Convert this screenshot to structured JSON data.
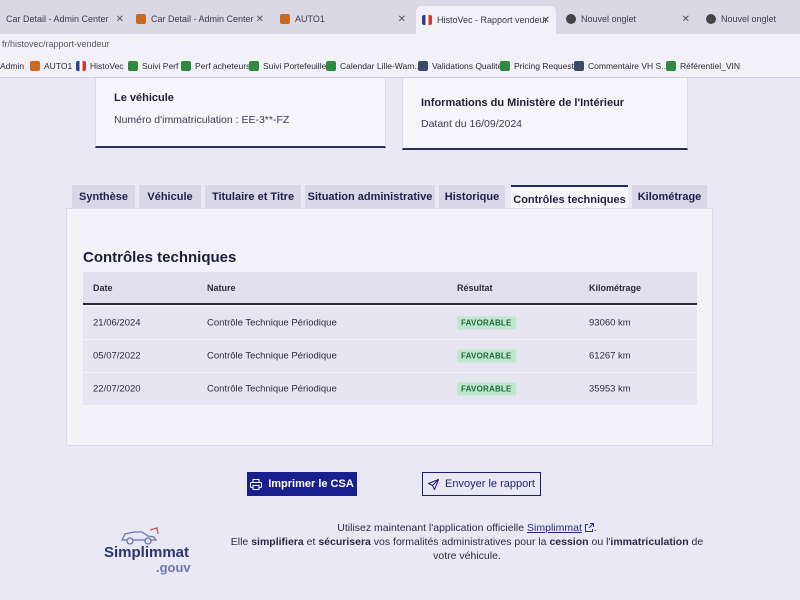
{
  "browser": {
    "tabs": [
      {
        "title": "Car Detail - Admin Center",
        "active": false
      },
      {
        "title": "Car Detail - Admin Center",
        "active": false
      },
      {
        "title": "AUTO1",
        "active": false
      },
      {
        "title": "HistoVec - Rapport vendeur",
        "active": true
      },
      {
        "title": "Nouvel onglet",
        "active": false
      },
      {
        "title": "Nouvel onglet",
        "active": false
      }
    ],
    "url": "fr/histovec/rapport-vendeur",
    "bookmarks": [
      "Admin",
      "AUTO1",
      "HistoVec",
      "Suivi Perf",
      "Perf acheteurs",
      "Suivi Portefeuille",
      "Calendar Lille-Wam...",
      "Validations Qualité",
      "Pricing Requests",
      "Commentaire VH S...",
      "Référentiel_VIN"
    ]
  },
  "vehicle_card": {
    "title": "Le véhicule",
    "plate": "Numéro d'immatriculation : EE-3**-FZ"
  },
  "ministry_card": {
    "title": "Informations du Ministère de l'Intérieur",
    "date": "Datant du 16/09/2024"
  },
  "tabs": [
    "Synthèse",
    "Véhicule",
    "Titulaire et Titre",
    "Situation administrative",
    "Historique",
    "Contrôles techniques",
    "Kilométrage"
  ],
  "active_tab": "Contrôles techniques",
  "section": {
    "title": "Contrôles techniques",
    "columns": [
      "Date",
      "Nature",
      "Résultat",
      "Kilométrage"
    ],
    "rows": [
      {
        "date": "21/06/2024",
        "nature": "Contrôle Technique Périodique",
        "result": "FAVORABLE",
        "km": "93060 km"
      },
      {
        "date": "05/07/2022",
        "nature": "Contrôle Technique Périodique",
        "result": "FAVORABLE",
        "km": "61267 km"
      },
      {
        "date": "22/07/2020",
        "nature": "Contrôle Technique Périodique",
        "result": "FAVORABLE",
        "km": "35953 km"
      }
    ]
  },
  "buttons": {
    "print": "Imprimer le CSA",
    "send": "Envoyer le rapport"
  },
  "logo": {
    "name": "Simplimmat",
    "suffix": ".gouv"
  },
  "promo": {
    "line1_prefix": "Utilisez maintenant l'application officielle ",
    "line1_link": "Simplimmat",
    "line1_suffix": ".",
    "line2_a": "Elle ",
    "line2_b": "simplifiera",
    "line2_c": " et ",
    "line2_d": "sécurisera",
    "line2_e": " vos formalités administratives pour la ",
    "line2_f": "cession",
    "line2_g": " ou l'",
    "line2_h": "immatriculation",
    "line2_i": " de",
    "line3": "votre véhicule."
  },
  "colors": {
    "primary": "#1a1f8f",
    "badge_bg": "#bfe6cf",
    "badge_fg": "#1d6b3a"
  }
}
